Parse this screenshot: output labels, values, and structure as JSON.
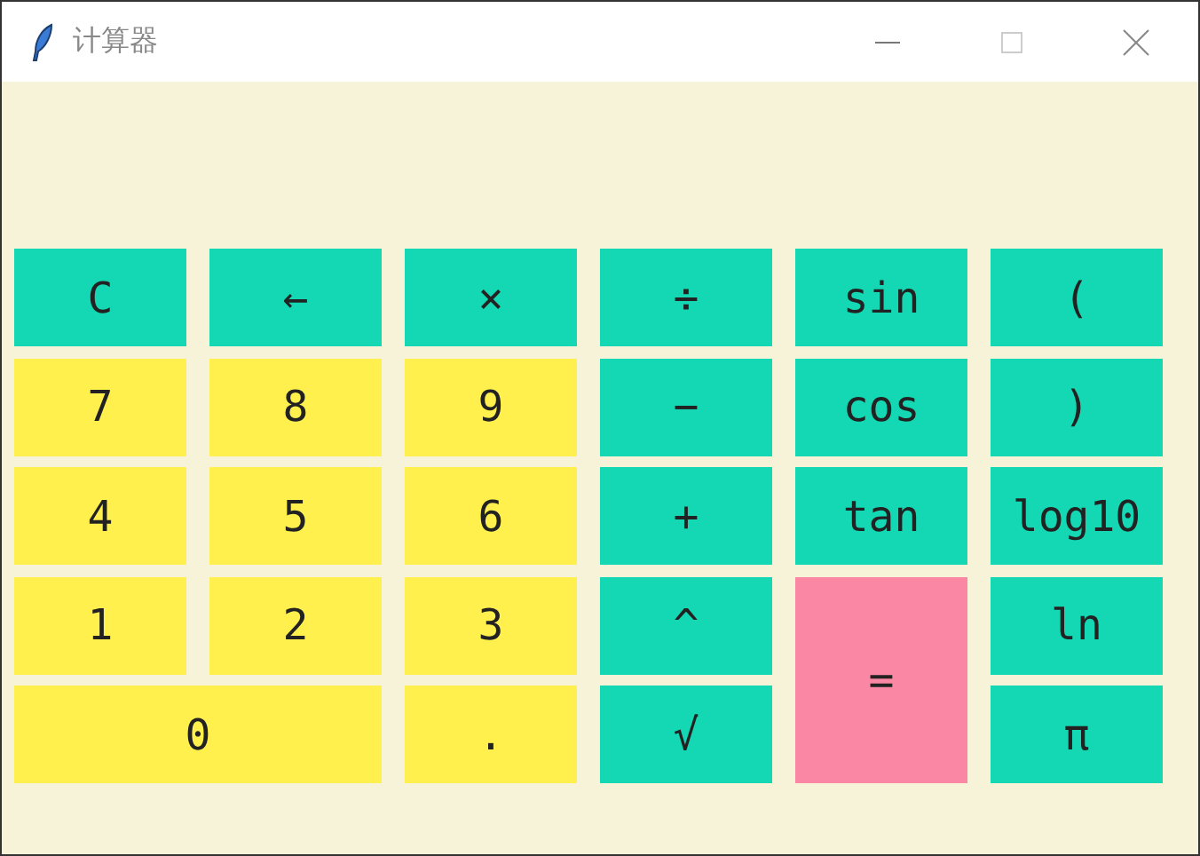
{
  "window": {
    "title": "计算器"
  },
  "buttons": [
    {
      "label": "C",
      "kind": "function"
    },
    {
      "label": "←",
      "kind": "function"
    },
    {
      "label": "×",
      "kind": "function"
    },
    {
      "label": "÷",
      "kind": "function"
    },
    {
      "label": "sin",
      "kind": "function"
    },
    {
      "label": "(",
      "kind": "function"
    },
    {
      "label": "7",
      "kind": "digit"
    },
    {
      "label": "8",
      "kind": "digit"
    },
    {
      "label": "9",
      "kind": "digit"
    },
    {
      "label": "−",
      "kind": "function"
    },
    {
      "label": "cos",
      "kind": "function"
    },
    {
      "label": ")",
      "kind": "function"
    },
    {
      "label": "4",
      "kind": "digit"
    },
    {
      "label": "5",
      "kind": "digit"
    },
    {
      "label": "6",
      "kind": "digit"
    },
    {
      "label": "+",
      "kind": "function"
    },
    {
      "label": "tan",
      "kind": "function"
    },
    {
      "label": "log10",
      "kind": "function"
    },
    {
      "label": "1",
      "kind": "digit"
    },
    {
      "label": "2",
      "kind": "digit"
    },
    {
      "label": "3",
      "kind": "digit"
    },
    {
      "label": "^",
      "kind": "function"
    },
    {
      "label": "=",
      "kind": "equals"
    },
    {
      "label": "ln",
      "kind": "function"
    },
    {
      "label": "0",
      "kind": "digit-wide"
    },
    {
      "label": ".",
      "kind": "digit"
    },
    {
      "label": "√",
      "kind": "function"
    },
    {
      "label": "π",
      "kind": "function"
    }
  ]
}
